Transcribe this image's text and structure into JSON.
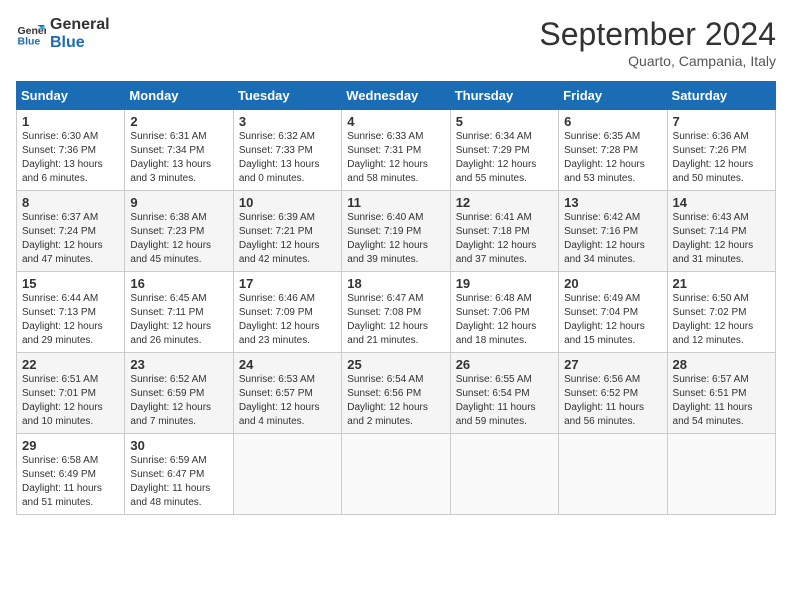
{
  "header": {
    "logo_line1": "General",
    "logo_line2": "Blue",
    "month": "September 2024",
    "location": "Quarto, Campania, Italy"
  },
  "weekdays": [
    "Sunday",
    "Monday",
    "Tuesday",
    "Wednesday",
    "Thursday",
    "Friday",
    "Saturday"
  ],
  "weeks": [
    [
      {
        "day": "1",
        "sunrise": "6:30 AM",
        "sunset": "7:36 PM",
        "daylight": "13 hours and 6 minutes."
      },
      {
        "day": "2",
        "sunrise": "6:31 AM",
        "sunset": "7:34 PM",
        "daylight": "13 hours and 3 minutes."
      },
      {
        "day": "3",
        "sunrise": "6:32 AM",
        "sunset": "7:33 PM",
        "daylight": "13 hours and 0 minutes."
      },
      {
        "day": "4",
        "sunrise": "6:33 AM",
        "sunset": "7:31 PM",
        "daylight": "12 hours and 58 minutes."
      },
      {
        "day": "5",
        "sunrise": "6:34 AM",
        "sunset": "7:29 PM",
        "daylight": "12 hours and 55 minutes."
      },
      {
        "day": "6",
        "sunrise": "6:35 AM",
        "sunset": "7:28 PM",
        "daylight": "12 hours and 53 minutes."
      },
      {
        "day": "7",
        "sunrise": "6:36 AM",
        "sunset": "7:26 PM",
        "daylight": "12 hours and 50 minutes."
      }
    ],
    [
      {
        "day": "8",
        "sunrise": "6:37 AM",
        "sunset": "7:24 PM",
        "daylight": "12 hours and 47 minutes."
      },
      {
        "day": "9",
        "sunrise": "6:38 AM",
        "sunset": "7:23 PM",
        "daylight": "12 hours and 45 minutes."
      },
      {
        "day": "10",
        "sunrise": "6:39 AM",
        "sunset": "7:21 PM",
        "daylight": "12 hours and 42 minutes."
      },
      {
        "day": "11",
        "sunrise": "6:40 AM",
        "sunset": "7:19 PM",
        "daylight": "12 hours and 39 minutes."
      },
      {
        "day": "12",
        "sunrise": "6:41 AM",
        "sunset": "7:18 PM",
        "daylight": "12 hours and 37 minutes."
      },
      {
        "day": "13",
        "sunrise": "6:42 AM",
        "sunset": "7:16 PM",
        "daylight": "12 hours and 34 minutes."
      },
      {
        "day": "14",
        "sunrise": "6:43 AM",
        "sunset": "7:14 PM",
        "daylight": "12 hours and 31 minutes."
      }
    ],
    [
      {
        "day": "15",
        "sunrise": "6:44 AM",
        "sunset": "7:13 PM",
        "daylight": "12 hours and 29 minutes."
      },
      {
        "day": "16",
        "sunrise": "6:45 AM",
        "sunset": "7:11 PM",
        "daylight": "12 hours and 26 minutes."
      },
      {
        "day": "17",
        "sunrise": "6:46 AM",
        "sunset": "7:09 PM",
        "daylight": "12 hours and 23 minutes."
      },
      {
        "day": "18",
        "sunrise": "6:47 AM",
        "sunset": "7:08 PM",
        "daylight": "12 hours and 21 minutes."
      },
      {
        "day": "19",
        "sunrise": "6:48 AM",
        "sunset": "7:06 PM",
        "daylight": "12 hours and 18 minutes."
      },
      {
        "day": "20",
        "sunrise": "6:49 AM",
        "sunset": "7:04 PM",
        "daylight": "12 hours and 15 minutes."
      },
      {
        "day": "21",
        "sunrise": "6:50 AM",
        "sunset": "7:02 PM",
        "daylight": "12 hours and 12 minutes."
      }
    ],
    [
      {
        "day": "22",
        "sunrise": "6:51 AM",
        "sunset": "7:01 PM",
        "daylight": "12 hours and 10 minutes."
      },
      {
        "day": "23",
        "sunrise": "6:52 AM",
        "sunset": "6:59 PM",
        "daylight": "12 hours and 7 minutes."
      },
      {
        "day": "24",
        "sunrise": "6:53 AM",
        "sunset": "6:57 PM",
        "daylight": "12 hours and 4 minutes."
      },
      {
        "day": "25",
        "sunrise": "6:54 AM",
        "sunset": "6:56 PM",
        "daylight": "12 hours and 2 minutes."
      },
      {
        "day": "26",
        "sunrise": "6:55 AM",
        "sunset": "6:54 PM",
        "daylight": "11 hours and 59 minutes."
      },
      {
        "day": "27",
        "sunrise": "6:56 AM",
        "sunset": "6:52 PM",
        "daylight": "11 hours and 56 minutes."
      },
      {
        "day": "28",
        "sunrise": "6:57 AM",
        "sunset": "6:51 PM",
        "daylight": "11 hours and 54 minutes."
      }
    ],
    [
      {
        "day": "29",
        "sunrise": "6:58 AM",
        "sunset": "6:49 PM",
        "daylight": "11 hours and 51 minutes."
      },
      {
        "day": "30",
        "sunrise": "6:59 AM",
        "sunset": "6:47 PM",
        "daylight": "11 hours and 48 minutes."
      },
      null,
      null,
      null,
      null,
      null
    ]
  ]
}
